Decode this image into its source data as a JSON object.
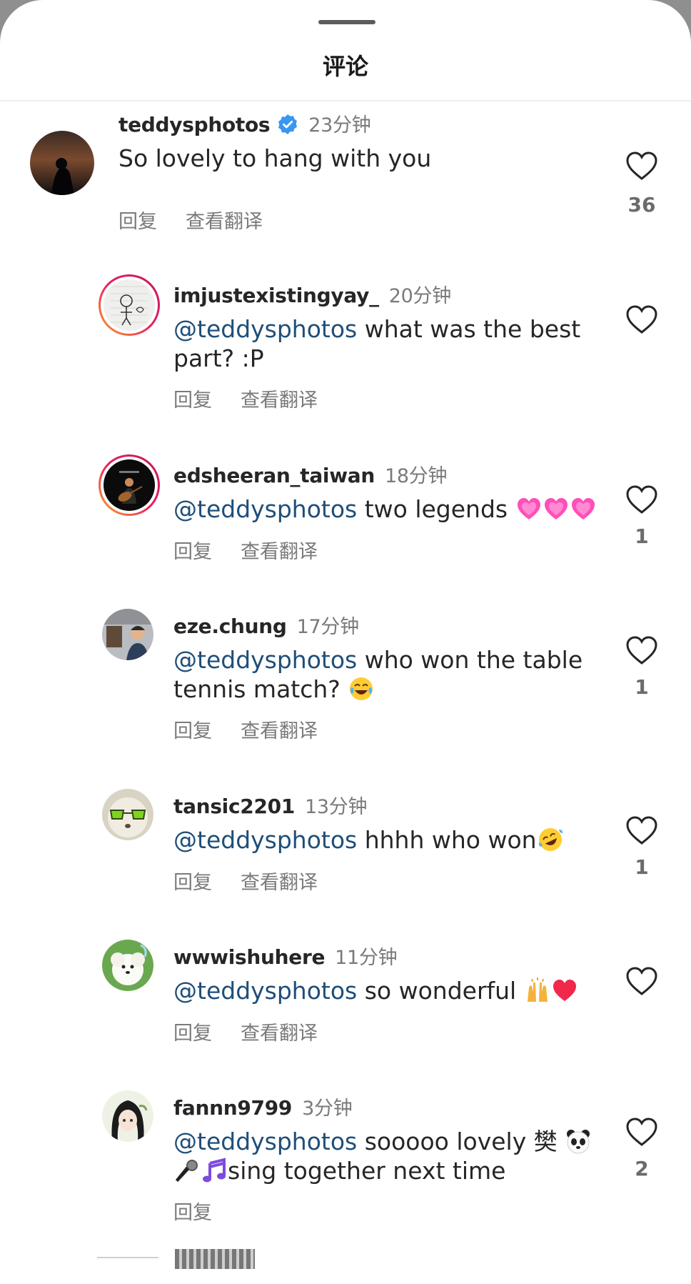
{
  "header": {
    "title": "评论"
  },
  "actions": {
    "reply": "回复",
    "translate": "查看翻译"
  },
  "comments": [
    {
      "username": "teddysphotos",
      "verified": true,
      "time": "23分钟",
      "mention": "",
      "text": "So lovely to hang with you",
      "likes": "36",
      "show_translate": true
    },
    {
      "username": "imjustexistingyay_",
      "time": "20分钟",
      "mention": "@teddysphotos",
      "text": " what was the best part? :P",
      "likes": "",
      "show_translate": true
    },
    {
      "username": "edsheeran_taiwan",
      "time": "18分钟",
      "mention": "@teddysphotos",
      "text": " two legends ",
      "emoji": [
        "growing-heart",
        "growing-heart",
        "growing-heart"
      ],
      "likes": "1",
      "show_translate": true
    },
    {
      "username": "eze.chung",
      "time": "17分钟",
      "mention": "@teddysphotos",
      "text": " who won the table tennis match? ",
      "emoji": [
        "tears-of-joy"
      ],
      "likes": "1",
      "show_translate": true
    },
    {
      "username": "tansic2201",
      "time": "13分钟",
      "mention": "@teddysphotos",
      "text": " hhhh who won",
      "emoji": [
        "rolling-laughing"
      ],
      "likes": "1",
      "show_translate": true
    },
    {
      "username": "wwwishuhere",
      "time": "11分钟",
      "mention": "@teddysphotos",
      "text": " so wonderful ",
      "emoji": [
        "raising-hands",
        "red-heart"
      ],
      "likes": "",
      "show_translate": true
    },
    {
      "username": "fannn9799",
      "time": "3分钟",
      "mention": "@teddysphotos",
      "text": " sooooo lovely 樊 ",
      "text2": "sing together next time",
      "emoji": [
        "panda",
        "microphone",
        "music-notes"
      ],
      "likes": "2",
      "show_translate": false
    }
  ],
  "colors": {
    "mention": "#1f4e79",
    "verified": "#3897f0",
    "story_ring_start": "#f9a825",
    "story_ring_end": "#c2185b",
    "emoji_heart": "#ff4fb8"
  }
}
